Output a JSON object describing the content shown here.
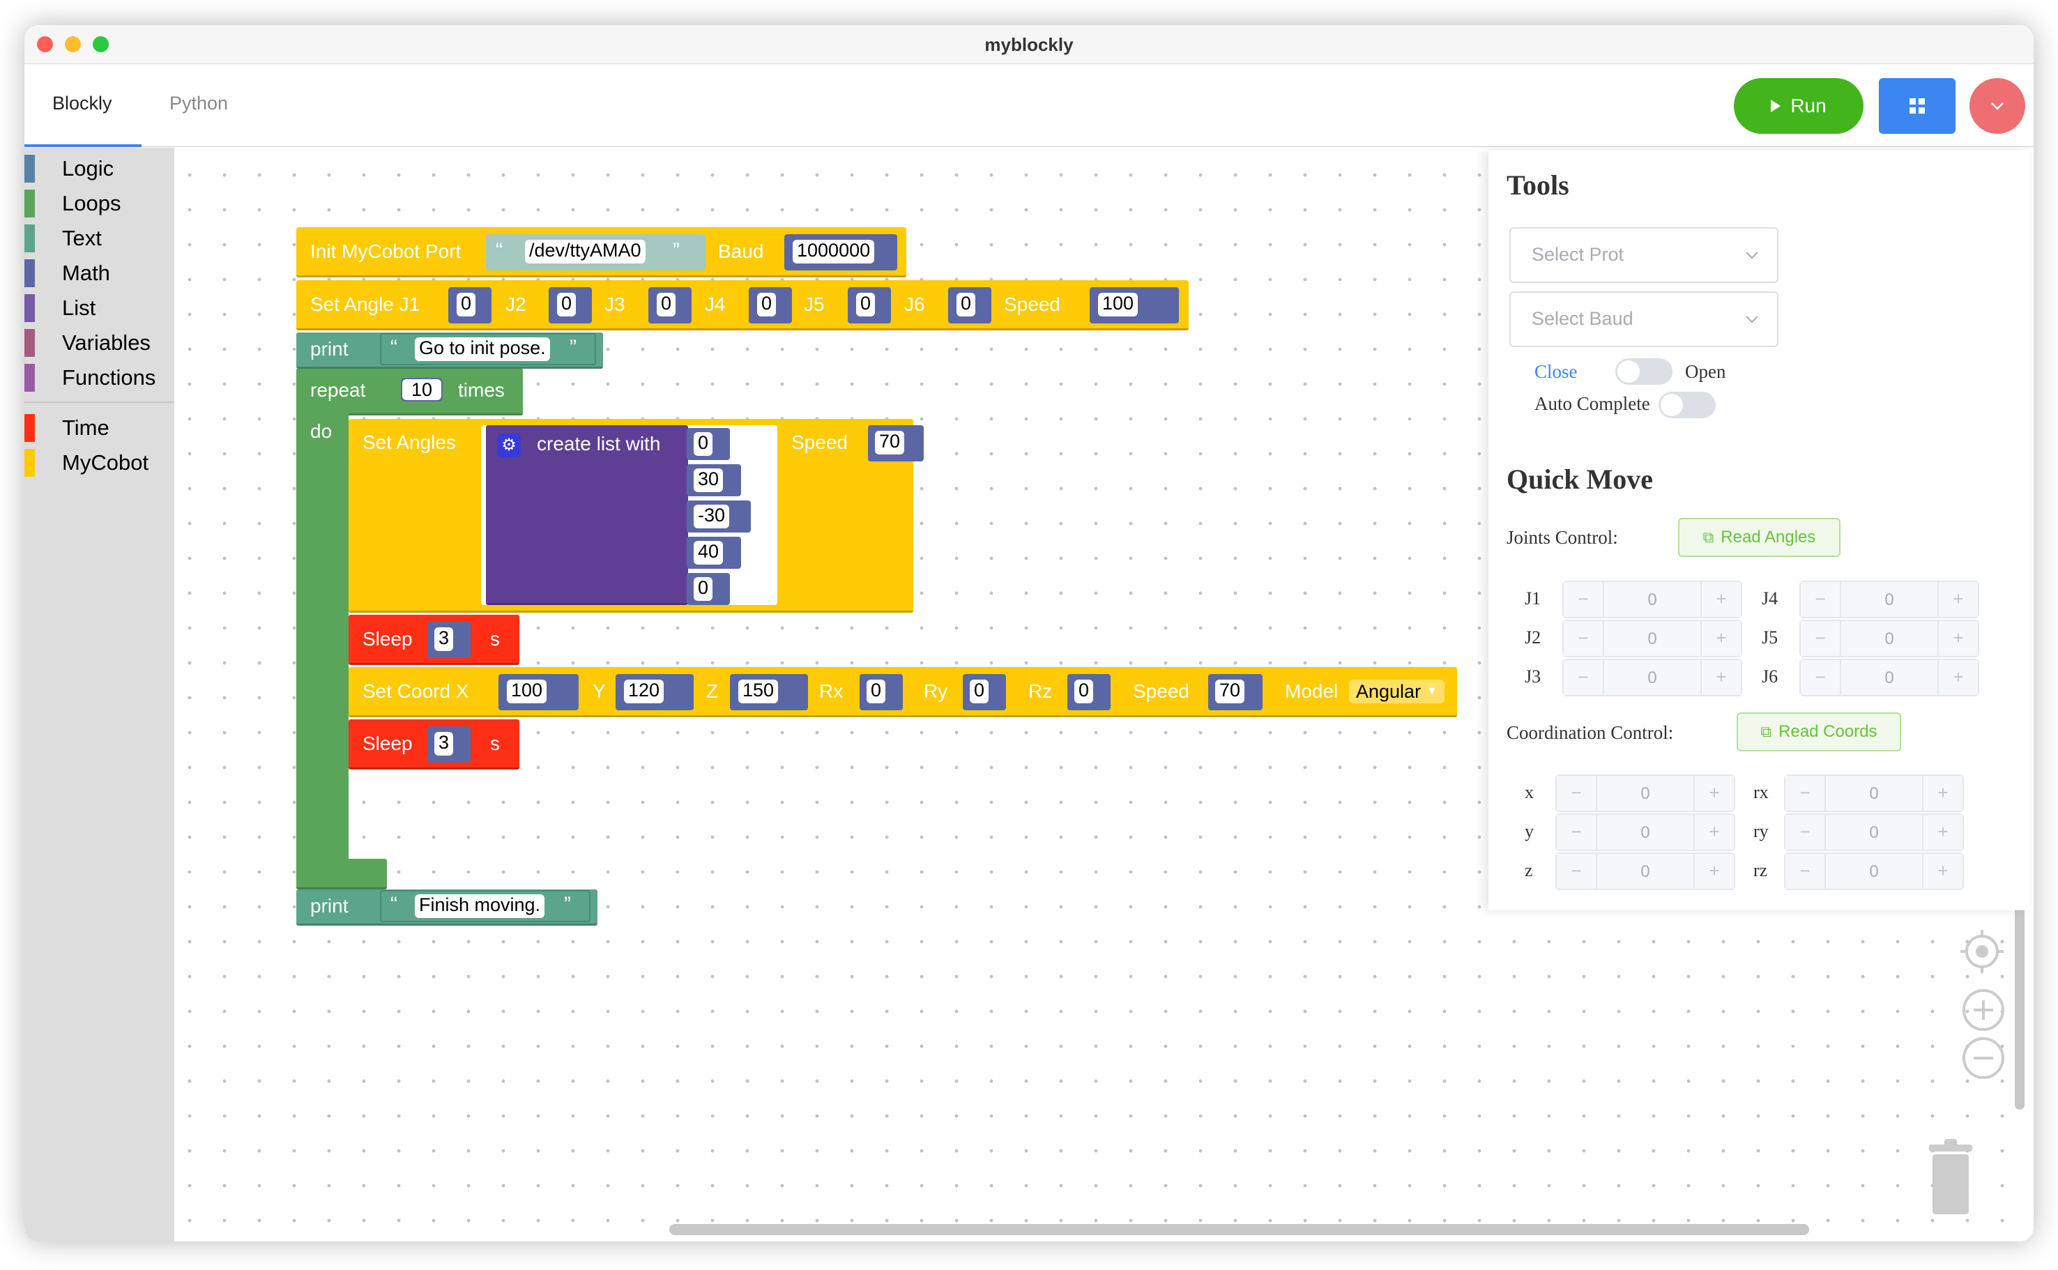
{
  "window": {
    "title": "myblockly"
  },
  "tabs": [
    {
      "label": "Blockly"
    },
    {
      "label": "Python"
    }
  ],
  "header": {
    "run_label": "Run",
    "colors": {
      "run": "#43b41c",
      "grid": "#3b86f0",
      "menu": "#ef6e71"
    }
  },
  "toolbox": [
    {
      "label": "Logic",
      "color": "#5b80a5"
    },
    {
      "label": "Loops",
      "color": "#5ba55b"
    },
    {
      "label": "Text",
      "color": "#5ba58c"
    },
    {
      "label": "Math",
      "color": "#5b67a5"
    },
    {
      "label": "List",
      "color": "#745ba5"
    },
    {
      "label": "Variables",
      "color": "#a55b80"
    },
    {
      "label": "Functions",
      "color": "#995ba5"
    },
    {
      "label": "Time",
      "color": "#fe2f15"
    },
    {
      "label": "MyCobot",
      "color": "#ffcb06"
    }
  ],
  "blocks": {
    "init": {
      "label": "Init MyCobot Port",
      "port": "/dev/ttyAMA0",
      "baud_label": "Baud",
      "baud": "1000000"
    },
    "set_angle": {
      "j1": "Set Angle J1",
      "j2": "J2",
      "j3": "J3",
      "j4": "J4",
      "j5": "J5",
      "j6": "J6",
      "speed_label": "Speed",
      "v1": "0",
      "v2": "0",
      "v3": "0",
      "v4": "0",
      "v5": "0",
      "v6": "0",
      "speed": "100"
    },
    "print1": {
      "label": "print",
      "text": "Go to init pose."
    },
    "repeat": {
      "label": "repeat",
      "count": "10",
      "times": "times",
      "do": "do"
    },
    "set_angles": {
      "label": "Set Angles",
      "list_label": "create list with",
      "values": [
        "0",
        "30",
        "-30",
        "40",
        "0"
      ],
      "speed_label": "Speed",
      "speed": "70"
    },
    "sleep1": {
      "label": "Sleep",
      "value": "3",
      "unit": "s"
    },
    "set_coord": {
      "x_label": "Set Coord X",
      "x": "100",
      "y_label": "Y",
      "y": "120",
      "z_label": "Z",
      "z": "150",
      "rx_label": "Rx",
      "rx": "0",
      "ry_label": "Ry",
      "ry": "0",
      "rz_label": "Rz",
      "rz": "0",
      "speed_label": "Speed",
      "speed": "70",
      "model_label": "Model",
      "model": "Angular"
    },
    "sleep2": {
      "label": "Sleep",
      "value": "3",
      "unit": "s"
    },
    "print2": {
      "label": "print",
      "text": "Finish moving."
    }
  },
  "tools": {
    "title": "Tools",
    "select_port_placeholder": "Select Prot",
    "select_baud_placeholder": "Select Baud",
    "close_label": "Close",
    "open_label": "Open",
    "auto_complete_label": "Auto Complete"
  },
  "quick_move": {
    "title": "Quick Move",
    "joints_label": "Joints Control:",
    "read_angles": "Read Angles",
    "joints": [
      {
        "name": "J1",
        "value": "0"
      },
      {
        "name": "J2",
        "value": "0"
      },
      {
        "name": "J3",
        "value": "0"
      },
      {
        "name": "J4",
        "value": "0"
      },
      {
        "name": "J5",
        "value": "0"
      },
      {
        "name": "J6",
        "value": "0"
      }
    ],
    "coords_label": "Coordination Control:",
    "read_coords": "Read Coords",
    "coords": [
      {
        "name": "x",
        "value": "0"
      },
      {
        "name": "y",
        "value": "0"
      },
      {
        "name": "z",
        "value": "0"
      },
      {
        "name": "rx",
        "value": "0"
      },
      {
        "name": "ry",
        "value": "0"
      },
      {
        "name": "rz",
        "value": "0"
      }
    ]
  }
}
